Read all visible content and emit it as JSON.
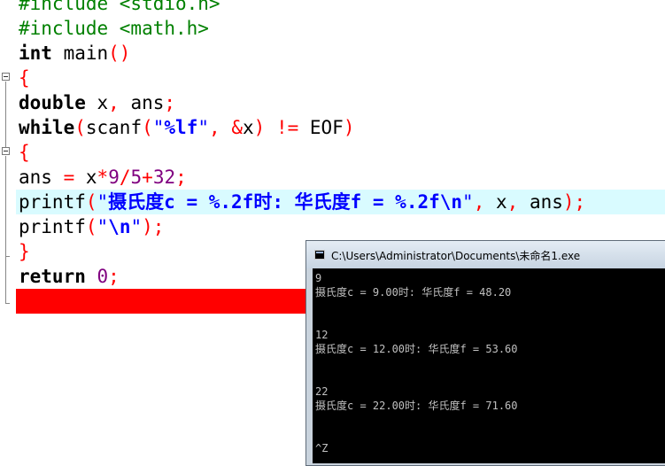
{
  "editor": {
    "lines": [
      {
        "tokens": [
          {
            "c": "pp",
            "t": "#include <stdio.h>"
          }
        ]
      },
      {
        "tokens": [
          {
            "c": "pp",
            "t": "#include <math.h>"
          }
        ]
      },
      {
        "tokens": [
          {
            "c": "kw",
            "t": "int"
          },
          {
            "c": "id",
            "t": " main"
          },
          {
            "c": "br",
            "t": "()"
          }
        ]
      },
      {
        "tokens": [
          {
            "c": "br",
            "t": "{"
          }
        ]
      },
      {
        "tokens": [
          {
            "c": "kw",
            "t": "double"
          },
          {
            "c": "id",
            "t": " x"
          },
          {
            "c": "op",
            "t": ","
          },
          {
            "c": "id",
            "t": " ans"
          },
          {
            "c": "op",
            "t": ";"
          }
        ]
      },
      {
        "tokens": [
          {
            "c": "kw",
            "t": "while"
          },
          {
            "c": "br",
            "t": "("
          },
          {
            "c": "id",
            "t": "scanf"
          },
          {
            "c": "br",
            "t": "("
          },
          {
            "c": "str",
            "t": "\""
          },
          {
            "c": "fmt",
            "t": "%lf"
          },
          {
            "c": "str",
            "t": "\""
          },
          {
            "c": "op",
            "t": ","
          },
          {
            "c": "id",
            "t": " "
          },
          {
            "c": "op",
            "t": "&"
          },
          {
            "c": "id",
            "t": "x"
          },
          {
            "c": "br",
            "t": ")"
          },
          {
            "c": "id",
            "t": " "
          },
          {
            "c": "op",
            "t": "!="
          },
          {
            "c": "id",
            "t": " EOF"
          },
          {
            "c": "br",
            "t": ")"
          }
        ]
      },
      {
        "tokens": [
          {
            "c": "br",
            "t": "{"
          }
        ]
      },
      {
        "tokens": [
          {
            "c": "id",
            "t": "ans "
          },
          {
            "c": "op",
            "t": "="
          },
          {
            "c": "id",
            "t": " x"
          },
          {
            "c": "op",
            "t": "*"
          },
          {
            "c": "num",
            "t": "9"
          },
          {
            "c": "op",
            "t": "/"
          },
          {
            "c": "num",
            "t": "5"
          },
          {
            "c": "op",
            "t": "+"
          },
          {
            "c": "num",
            "t": "32"
          },
          {
            "c": "op",
            "t": ";"
          }
        ]
      },
      {
        "highlight": "cyan",
        "tokens": [
          {
            "c": "id",
            "t": "printf"
          },
          {
            "c": "br",
            "t": "("
          },
          {
            "c": "str",
            "t": "\""
          },
          {
            "c": "fmt",
            "t": "摄氏度c = %.2f时: 华氏度f = %.2f\\n"
          },
          {
            "c": "str",
            "t": "\""
          },
          {
            "c": "op",
            "t": ","
          },
          {
            "c": "id",
            "t": " x"
          },
          {
            "c": "op",
            "t": ","
          },
          {
            "c": "id",
            "t": " ans"
          },
          {
            "c": "br",
            "t": ")"
          },
          {
            "c": "op",
            "t": ";"
          }
        ]
      },
      {
        "tokens": [
          {
            "c": "id",
            "t": "printf"
          },
          {
            "c": "br",
            "t": "("
          },
          {
            "c": "str",
            "t": "\""
          },
          {
            "c": "fmt",
            "t": "\\n"
          },
          {
            "c": "str",
            "t": "\""
          },
          {
            "c": "br",
            "t": ")"
          },
          {
            "c": "op",
            "t": ";"
          }
        ]
      },
      {
        "tokens": [
          {
            "c": "br",
            "t": "}"
          }
        ]
      },
      {
        "tokens": [
          {
            "c": "kw",
            "t": "return"
          },
          {
            "c": "id",
            "t": " "
          },
          {
            "c": "num",
            "t": "0"
          },
          {
            "c": "op",
            "t": ";"
          }
        ]
      },
      {
        "highlight": "red",
        "tokens": [
          {
            "c": "br",
            "t": "}"
          }
        ]
      }
    ]
  },
  "console": {
    "title": "C:\\Users\\Administrator\\Documents\\未命名1.exe",
    "lines": [
      "9",
      "摄氏度c = 9.00时: 华氏度f = 48.20",
      "",
      "",
      "12",
      "摄氏度c = 12.00时: 华氏度f = 53.60",
      "",
      "",
      "22",
      "摄氏度c = 22.00时: 华氏度f = 71.60",
      "",
      "",
      "^Z"
    ]
  },
  "colors": {
    "preprocessor": "#008000",
    "keyword": "#000000",
    "bracket": "#ff0000",
    "number": "#800080",
    "string": "#0000ff",
    "current_line": "#d9fbff",
    "error_line": "#ff0000",
    "console_bg": "#000000",
    "console_text": "#c0c0c0"
  },
  "icons": {
    "fold": "fold-minus-icon",
    "console": "console-window-icon"
  }
}
